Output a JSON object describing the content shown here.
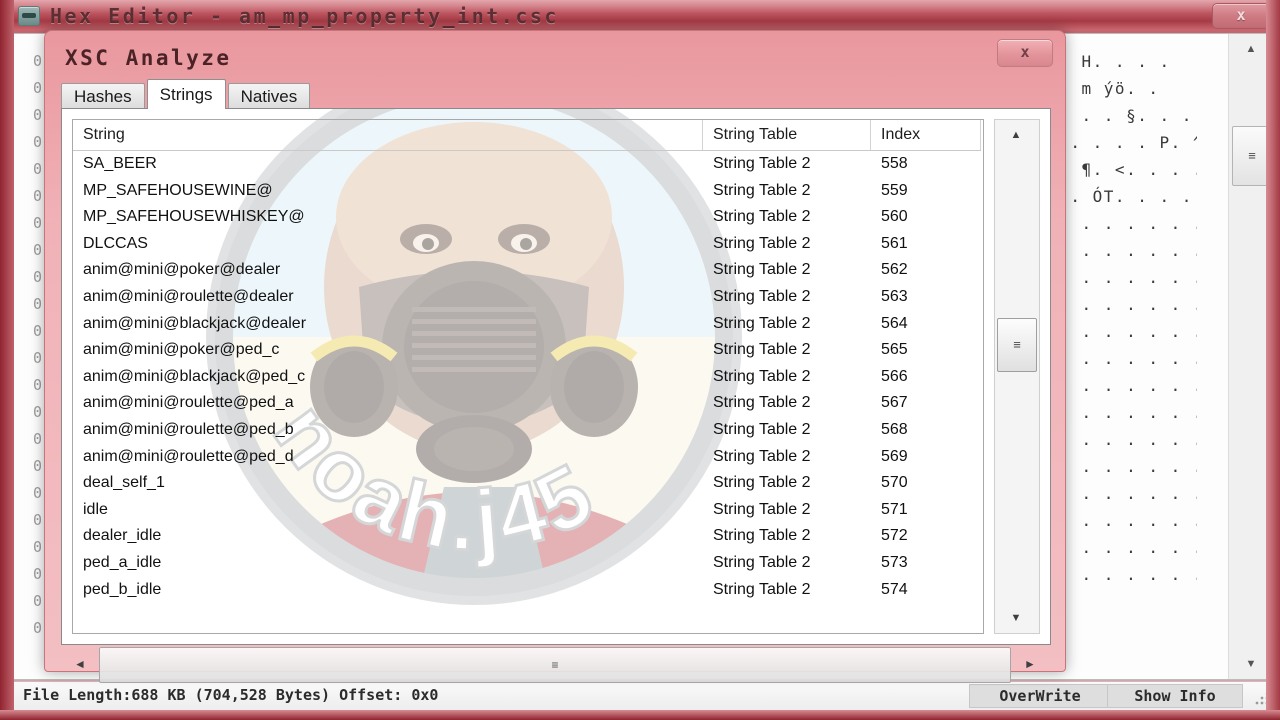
{
  "main_window": {
    "title": "Hex Editor - am_mp_property_int.csc",
    "app_icon": "hex-editor-icon",
    "close_label": "x",
    "hex_offsets": [
      "0",
      "0",
      "0",
      "0",
      "0",
      "0",
      "0",
      "0",
      "0",
      "0",
      "0",
      "0",
      "0",
      "0",
      "0",
      "0",
      "0",
      "0",
      "0",
      "0",
      "0",
      "0"
    ],
    "hex_ascii_lines": [
      "... H. . . .",
      "ÀP. m ýö. .",
      ". . . . §. . . .",
      "P. . . . . P. ^",
      ". . ¶. <. . . .",
      "n@ . ÓT. . . .",
      ". . . . . . . . .",
      ". . . . . . . . .",
      ". . . . . . . . .",
      ". . . . . . . . .",
      ". . . . . . . . .",
      ". . . . . . . . .",
      ". . . . . . . . .",
      ". . . . . . . . .",
      ". . . . . . . . .",
      ". . . . . . . . .",
      ". . . . . . . . .",
      ". . . . . . . . .",
      ". . . . . . . . .",
      ". . . . . . . . ."
    ],
    "status_bar": {
      "file_info": "File Length:688 KB (704,528 Bytes) Offset: 0x0",
      "overwrite_label": "OverWrite",
      "show_info_label": "Show Info"
    }
  },
  "dialog": {
    "title": "XSC Analyze",
    "close_label": "x",
    "tabs": [
      {
        "label": "Hashes",
        "active": false
      },
      {
        "label": "Strings",
        "active": true
      },
      {
        "label": "Natives",
        "active": false
      }
    ],
    "list": {
      "columns": [
        "String",
        "String Table",
        "Index"
      ],
      "rows": [
        {
          "string": "SA_BEER",
          "table": "String Table 2",
          "index": "558"
        },
        {
          "string": "MP_SAFEHOUSEWINE@",
          "table": "String Table 2",
          "index": "559"
        },
        {
          "string": "MP_SAFEHOUSEWHISKEY@",
          "table": "String Table 2",
          "index": "560"
        },
        {
          "string": "DLCCAS",
          "table": "String Table 2",
          "index": "561"
        },
        {
          "string": "anim@mini@poker@dealer",
          "table": "String Table 2",
          "index": "562"
        },
        {
          "string": "anim@mini@roulette@dealer",
          "table": "String Table 2",
          "index": "563"
        },
        {
          "string": "anim@mini@blackjack@dealer",
          "table": "String Table 2",
          "index": "564"
        },
        {
          "string": "anim@mini@poker@ped_c",
          "table": "String Table 2",
          "index": "565"
        },
        {
          "string": "anim@mini@blackjack@ped_c",
          "table": "String Table 2",
          "index": "566"
        },
        {
          "string": "anim@mini@roulette@ped_a",
          "table": "String Table 2",
          "index": "567"
        },
        {
          "string": "anim@mini@roulette@ped_b",
          "table": "String Table 2",
          "index": "568"
        },
        {
          "string": "anim@mini@roulette@ped_d",
          "table": "String Table 2",
          "index": "569"
        },
        {
          "string": "deal_self_1",
          "table": "String Table 2",
          "index": "570"
        },
        {
          "string": "idle",
          "table": "String Table 2",
          "index": "571"
        },
        {
          "string": "dealer_idle",
          "table": "String Table 2",
          "index": "572"
        },
        {
          "string": "ped_a_idle",
          "table": "String Table 2",
          "index": "573"
        },
        {
          "string": "ped_b_idle",
          "table": "String Table 2",
          "index": "574"
        }
      ]
    },
    "scrollbars": {
      "up_arrow": "▲",
      "down_arrow": "▼",
      "left_arrow": "◄",
      "right_arrow": "►",
      "thumb_grip": "≡"
    }
  },
  "watermark": {
    "text": "noah.j45",
    "description": "gas-mask-character-logo"
  },
  "colors": {
    "title_bar": "#c05a64",
    "dialog_header": "#efb0b6",
    "accent": "#a63a45",
    "list_background": "#ffffff"
  }
}
